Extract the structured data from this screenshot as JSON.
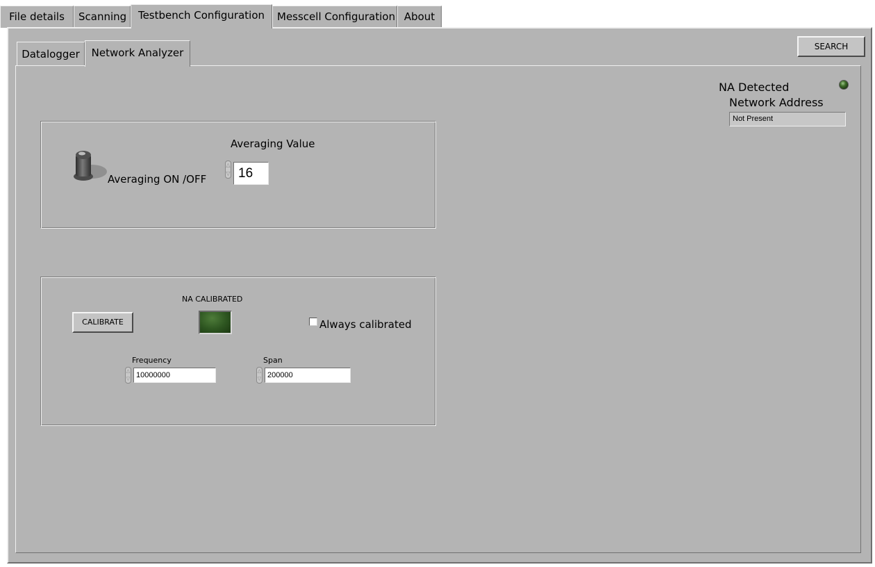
{
  "tabs": {
    "file_details": "File details",
    "scanning": "Scanning",
    "testbench_configuration": "Testbench Configuration",
    "messcell_configuration": "Messcell Configuration",
    "about": "About"
  },
  "subtabs": {
    "datalogger": "Datalogger",
    "network_analyzer": "Network Analyzer"
  },
  "search_button": "SEARCH",
  "na_detected": {
    "label": "NA Detected",
    "led_on": false
  },
  "network_address": {
    "label": "Network Address",
    "value": "Not Present"
  },
  "averaging": {
    "toggle_label": "Averaging ON /OFF",
    "toggle_on": false,
    "value_label": "Averaging Value",
    "value": "16"
  },
  "calibration": {
    "button": "CALIBRATE",
    "indicator_label": "NA CALIBRATED",
    "indicator_on": false,
    "always_calibrated_label": "Always calibrated",
    "always_calibrated_checked": false,
    "frequency_label": "Frequency",
    "frequency_value": "10000000",
    "span_label": "Span",
    "span_value": "200000"
  },
  "colors": {
    "panel": "#b4b4b4",
    "led_off": "#2f5a1c",
    "indicator_off": "#2c5520"
  },
  "icons": {
    "spinner": "up-down-arrows-icon",
    "toggle": "toggle-switch-icon",
    "led": "led-indicator-icon"
  }
}
